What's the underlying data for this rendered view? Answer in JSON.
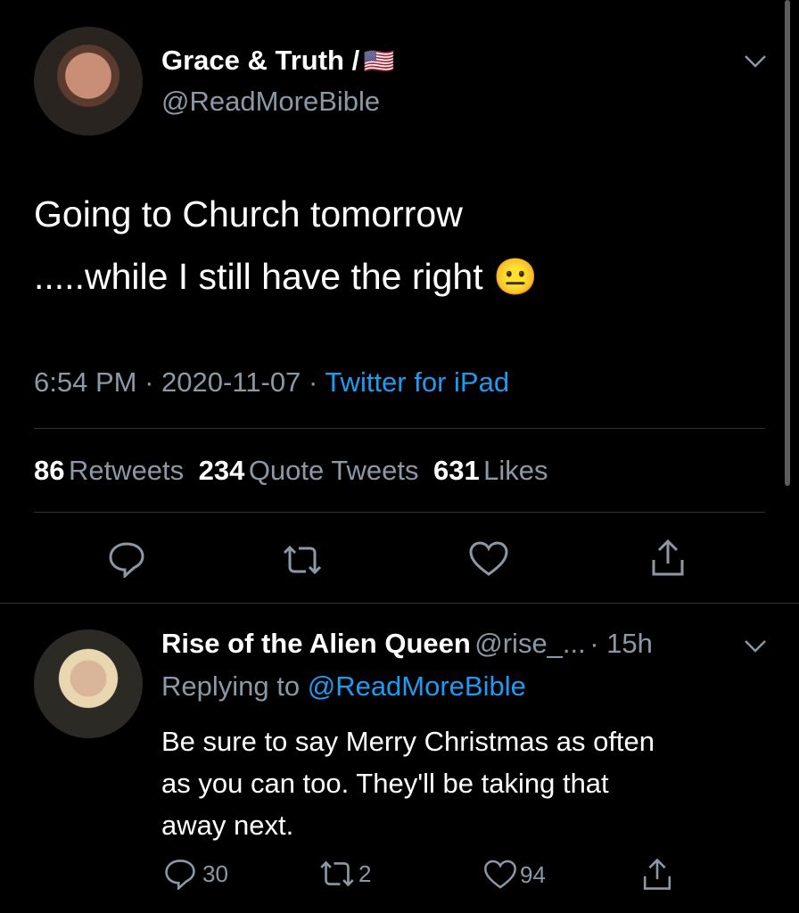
{
  "tweet": {
    "author_name": "Grace & Truth /",
    "author_flag": "🇺🇸",
    "author_handle": "@ReadMoreBible",
    "text_line1": "Going to Church tomorrow",
    "text_line2": ".....while I still have the right",
    "emoji": "😐",
    "time": "6:54 PM",
    "sep1": "·",
    "date": "2020-11-07",
    "sep2": "·",
    "source": "Twitter for iPad",
    "retweets_count": "86",
    "retweets_label": "Retweets",
    "quotes_count": "234",
    "quotes_label": "Quote Tweets",
    "likes_count": "631",
    "likes_label": "Likes"
  },
  "reply": {
    "author_name": "Rise of the Alien Queen",
    "author_handle": "@rise_...",
    "time": "· 15h",
    "replying_prefix": "Replying to",
    "replying_handle": "@ReadMoreBible",
    "text_line1": "Be sure to say Merry Christmas as often",
    "text_line2": "as you can too. They'll be taking that",
    "text_line3": "away next.",
    "reply_count": "30",
    "retweet_count": "2",
    "like_count": "94"
  },
  "colors": {
    "background": "#000000",
    "secondary_text": "#8b98a5",
    "link": "#1d9bf0",
    "divider": "#2f3336"
  },
  "icons": [
    "chevron-down-icon",
    "reply-icon",
    "retweet-icon",
    "like-icon",
    "share-icon"
  ]
}
